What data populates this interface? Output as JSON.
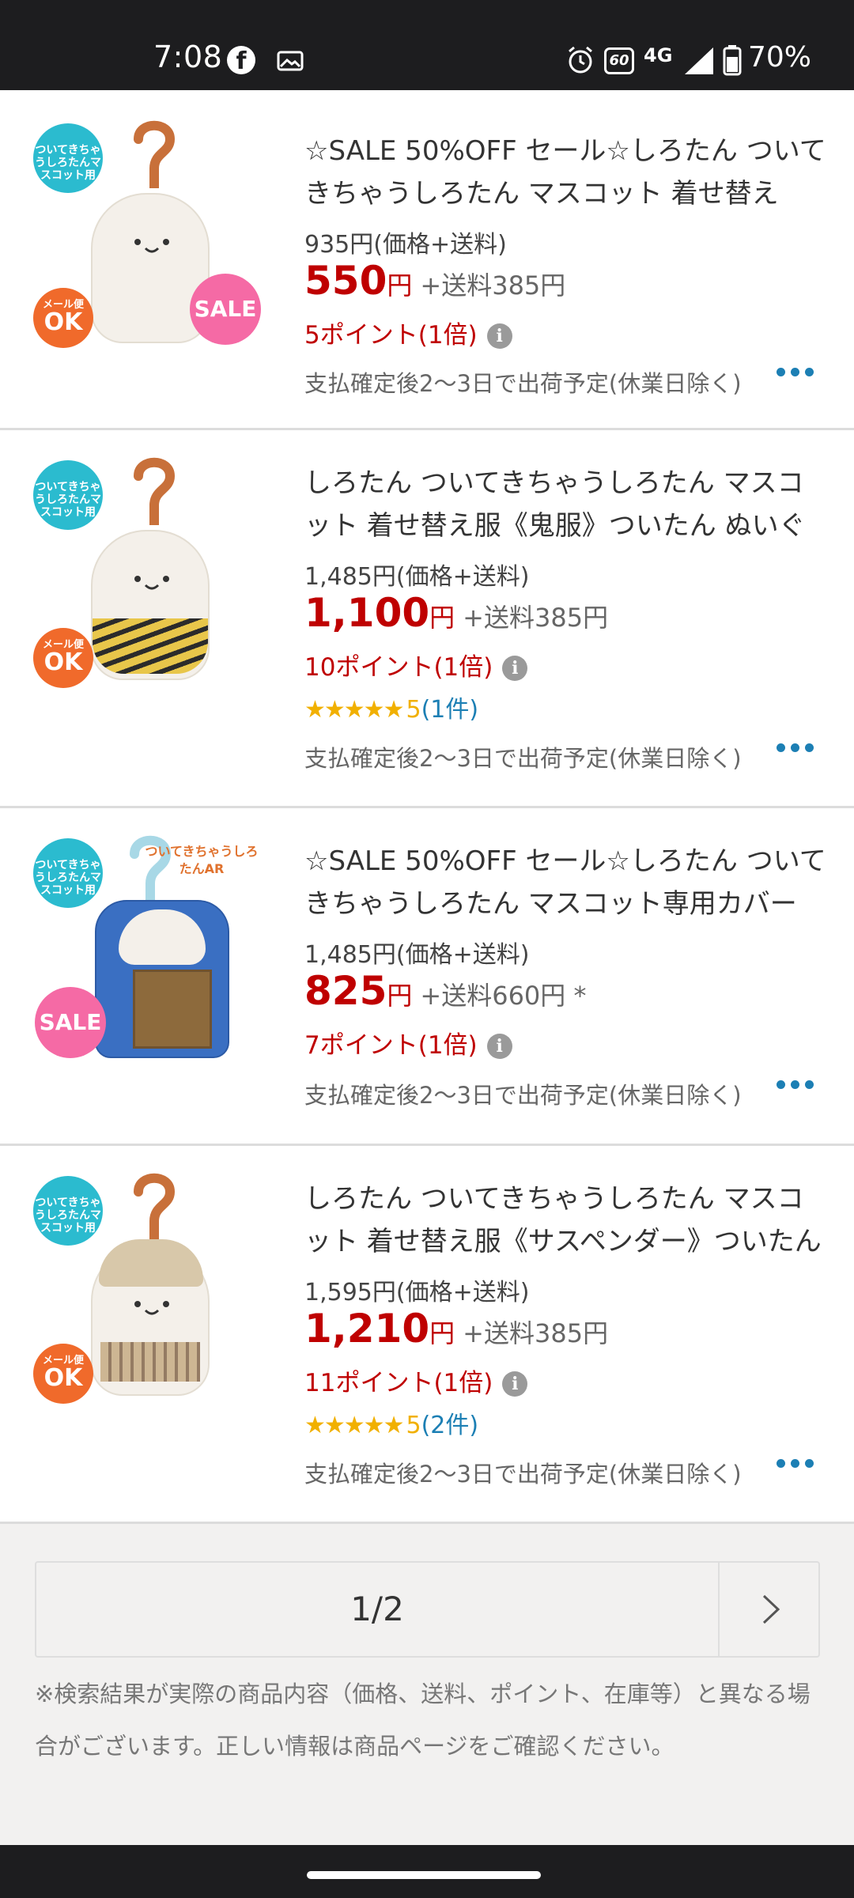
{
  "status_bar": {
    "time": "7:08",
    "refresh_rate": "60",
    "network": "4G",
    "battery_percent": "70%"
  },
  "products": [
    {
      "title": "☆SALE 50%OFF セール☆しろたん ついてきちゃうしろたん マスコット 着せ替え服…",
      "price_total": "935円(価格+送料)",
      "price": "550",
      "yen": "円",
      "shipping": "+送料385円",
      "points": "5ポイント(1倍)",
      "shipping_note": "支払確定後2〜3日で出荷予定(休業日除く)",
      "badges": [
        "メール便OK",
        "SALE"
      ]
    },
    {
      "title": "しろたん ついてきちゃうしろたん マスコット 着せ替え服《鬼服》ついたん ぬいぐるみ …",
      "price_total": "1,485円(価格+送料)",
      "price": "1,100",
      "yen": "円",
      "shipping": "+送料385円",
      "points": "10ポイント(1倍)",
      "rating": {
        "stars": "★★★★★",
        "score": "5",
        "count": "(1件)"
      },
      "shipping_note": "支払確定後2〜3日で出荷予定(休業日除く)",
      "badges": [
        "メール便OK"
      ]
    },
    {
      "title": "☆SALE 50%OFF セール☆しろたん ついてきちゃうしろたん マスコット専用カバー A…",
      "price_total": "1,485円(価格+送料)",
      "price": "825",
      "yen": "円",
      "shipping": "+送料660円 *",
      "points": "7ポイント(1倍)",
      "shipping_note": "支払確定後2〜3日で出荷予定(休業日除く)",
      "badges": [
        "SALE"
      ]
    },
    {
      "title": "しろたん ついてきちゃうしろたん マスコット 着せ替え服《サスペンダー》ついたん ぬ…",
      "price_total": "1,595円(価格+送料)",
      "price": "1,210",
      "yen": "円",
      "shipping": "+送料385円",
      "points": "11ポイント(1倍)",
      "rating": {
        "stars": "★★★★★",
        "score": "5",
        "count": "(2件)"
      },
      "shipping_note": "支払確定後2〜3日で出荷予定(休業日除く)",
      "badges": [
        "メール便OK"
      ]
    }
  ],
  "badge_text": {
    "mail_small": "メール便",
    "mail_big": "OK",
    "sale": "SALE",
    "mascot": "ついてきちゃうしろたんマスコット用",
    "ar_label": "ついてきちゃうしろたんAR"
  },
  "pagination": {
    "label": "1/2"
  },
  "disclaimer": "※検索結果が実際の商品内容（価格、送料、ポイント、在庫等）と異なる場合がございます。正しい情報は商品ページをご確認ください。",
  "colors": {
    "price_red": "#bf0000",
    "link_blue": "#1c7fb4",
    "star_gold": "#f1b000",
    "status_bar": "#1d1d1f"
  }
}
